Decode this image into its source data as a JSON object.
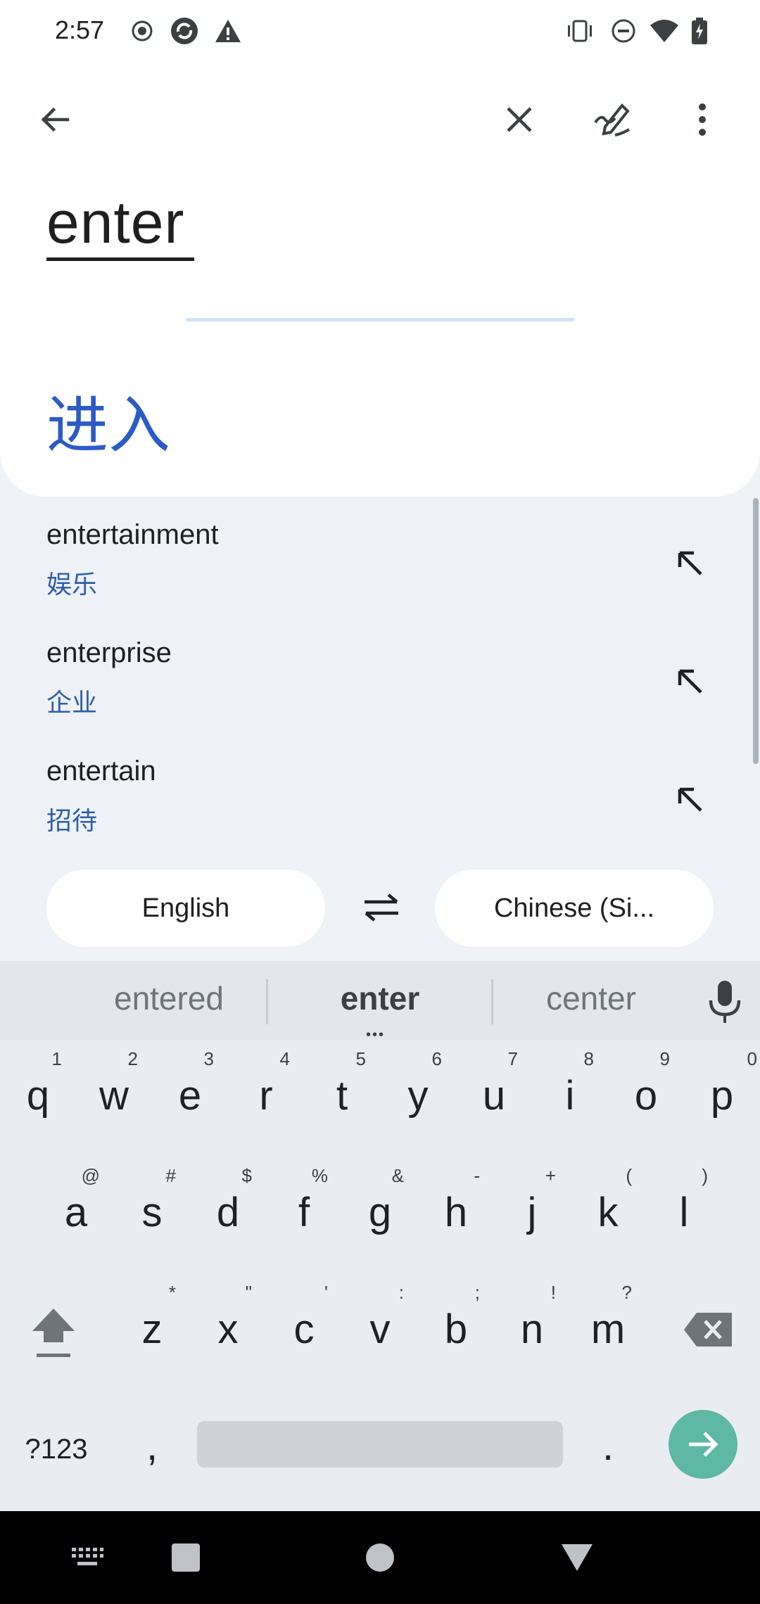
{
  "status_bar": {
    "time": "2:57",
    "left_icons": [
      "record-icon",
      "sync-icon",
      "warning-icon"
    ],
    "right_icons": [
      "vibrate-icon",
      "dnd-icon",
      "wifi-icon",
      "battery-icon"
    ]
  },
  "appbar": {
    "icons": [
      "back-icon",
      "close-icon",
      "handwriting-icon",
      "more-icon"
    ]
  },
  "translation": {
    "source": "enter",
    "target": "进入"
  },
  "suggestions": [
    {
      "word": "entertainment",
      "translation": "娱乐"
    },
    {
      "word": "enterprise",
      "translation": "企业"
    },
    {
      "word": "entertain",
      "translation": "招待"
    }
  ],
  "languages": {
    "source": "English",
    "target": "Chinese (Si..."
  },
  "keyboard": {
    "suggestions": [
      "entered",
      "enter",
      "center"
    ],
    "row1": [
      {
        "key": "q",
        "hint": "1"
      },
      {
        "key": "w",
        "hint": "2"
      },
      {
        "key": "e",
        "hint": "3"
      },
      {
        "key": "r",
        "hint": "4"
      },
      {
        "key": "t",
        "hint": "5"
      },
      {
        "key": "y",
        "hint": "6"
      },
      {
        "key": "u",
        "hint": "7"
      },
      {
        "key": "i",
        "hint": "8"
      },
      {
        "key": "o",
        "hint": "9"
      },
      {
        "key": "p",
        "hint": "0"
      }
    ],
    "row2": [
      {
        "key": "a",
        "hint": "@"
      },
      {
        "key": "s",
        "hint": "#"
      },
      {
        "key": "d",
        "hint": "$"
      },
      {
        "key": "f",
        "hint": "%"
      },
      {
        "key": "g",
        "hint": "&"
      },
      {
        "key": "h",
        "hint": "-"
      },
      {
        "key": "j",
        "hint": "+"
      },
      {
        "key": "k",
        "hint": "("
      },
      {
        "key": "l",
        "hint": ")"
      }
    ],
    "row3": [
      {
        "key": "z",
        "hint": "*"
      },
      {
        "key": "x",
        "hint": "\""
      },
      {
        "key": "c",
        "hint": "'"
      },
      {
        "key": "v",
        "hint": ":"
      },
      {
        "key": "b",
        "hint": ";"
      },
      {
        "key": "n",
        "hint": "!"
      },
      {
        "key": "m",
        "hint": "?"
      }
    ],
    "symbols_label": "?123",
    "comma": ",",
    "period": "."
  },
  "navbar": {
    "icons": [
      "keyboard-switch-icon",
      "recents-icon",
      "home-icon",
      "back-nav-icon"
    ]
  },
  "colors": {
    "accent_blue": "#2b5bc6",
    "enter_key": "#5fb7a6",
    "background": "#eef2f7"
  }
}
